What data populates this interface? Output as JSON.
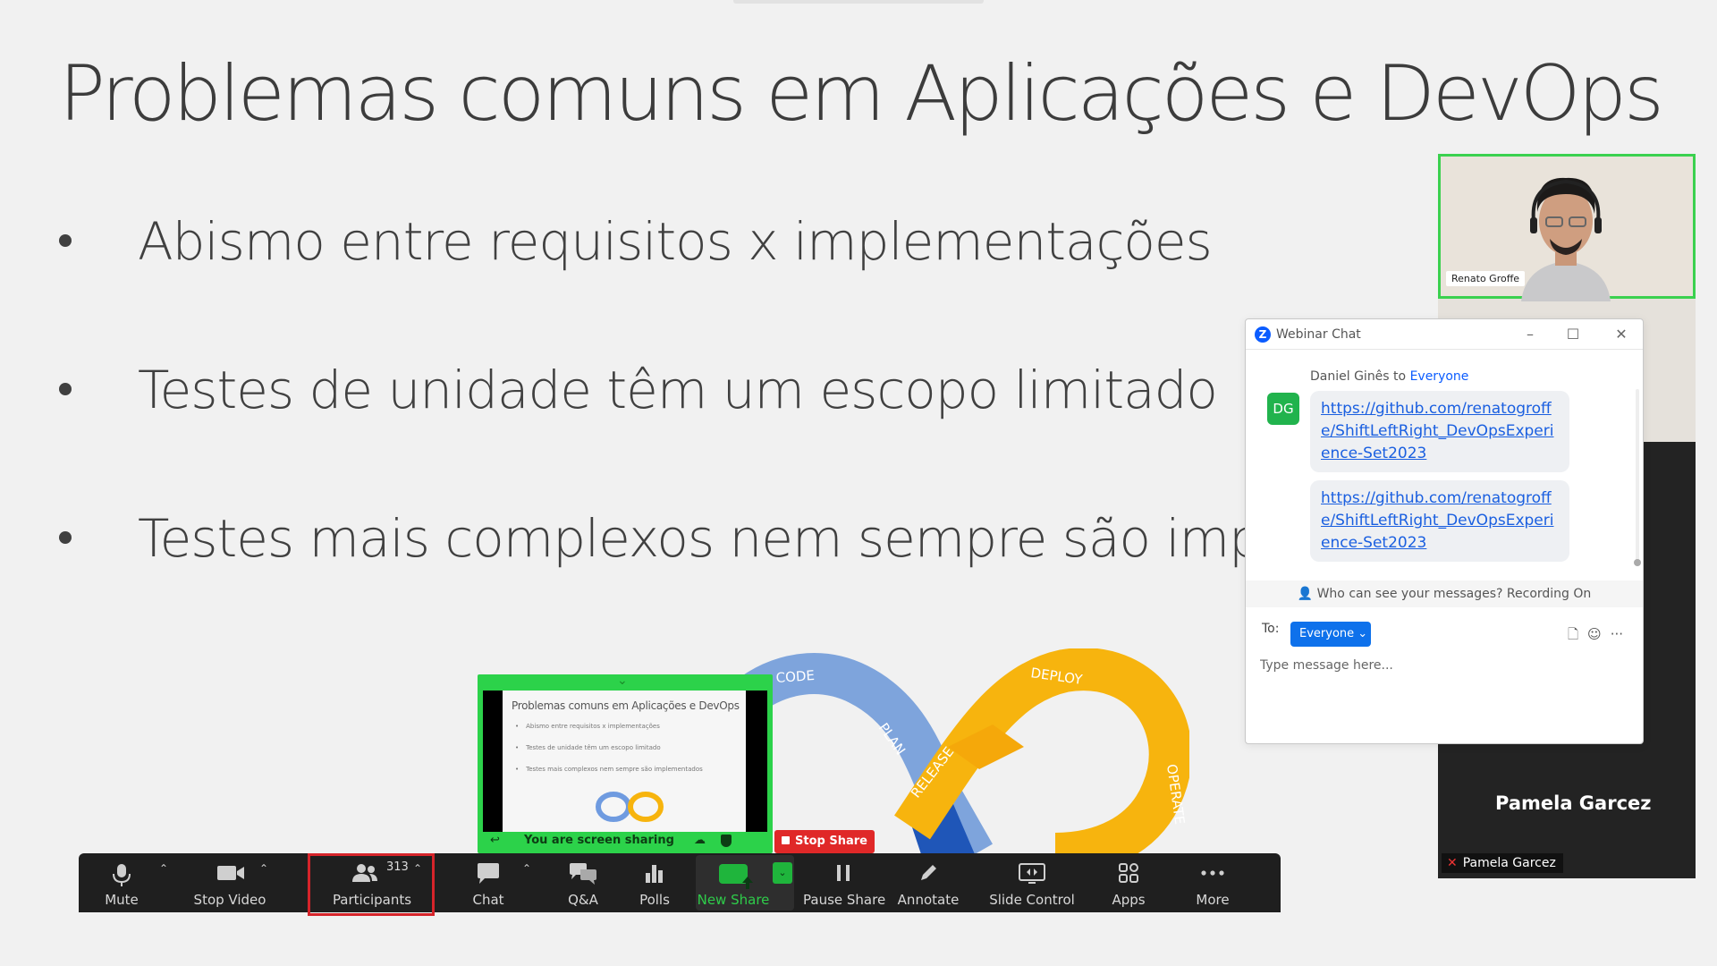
{
  "slide": {
    "title": "Problemas comuns em Aplicações e DevOps",
    "bullets": [
      "Abismo entre requisitos x implementações",
      "Testes de unidade têm um escopo limitado",
      "Testes mais complexos nem sempre são implementados"
    ],
    "diagram_labels": [
      "CODE",
      "PLAN",
      "RELEASE",
      "DEPLOY",
      "OPERATE"
    ]
  },
  "share_preview": {
    "title": "Problemas comuns em Aplicações e DevOps",
    "bullets": [
      "Abismo entre requisitos x implementações",
      "Testes de unidade têm um escopo limitado",
      "Testes mais complexos nem sempre são implementados"
    ],
    "status": "You are screen sharing",
    "stop_label": "Stop Share"
  },
  "toolbar": {
    "mute": "Mute",
    "stop_video": "Stop Video",
    "participants": "Participants",
    "participants_count": "313",
    "chat": "Chat",
    "qa": "Q&A",
    "polls": "Polls",
    "new_share": "New Share",
    "pause_share": "Pause Share",
    "annotate": "Annotate",
    "slide_control": "Slide Control",
    "apps": "Apps",
    "more": "More"
  },
  "videos": {
    "active_speaker": "Renato Groffe",
    "tile_name": "Pamela Garcez",
    "tile_tag": "Pamela Garcez"
  },
  "chat": {
    "window_title": "Webinar Chat",
    "sender": "Daniel Ginês",
    "to_word": "to",
    "recipient": "Everyone",
    "avatar_initials": "DG",
    "messages": [
      "https://github.com/renatogroffe/ShiftLeftRight_DevOpsExperience-Set2023",
      "https://github.com/renatogroffe/ShiftLeftRight_DevOpsExperience-Set2023"
    ],
    "visibility_note": "Who can see your messages? Recording On",
    "to_label": "To:",
    "to_value": "Everyone",
    "placeholder": "Type message here..."
  },
  "colors": {
    "share_green": "#2cd24a",
    "stop_red": "#e02828",
    "zoom_blue": "#0e71eb",
    "highlight_red": "#d6242a",
    "active_border": "#3bd14f"
  }
}
